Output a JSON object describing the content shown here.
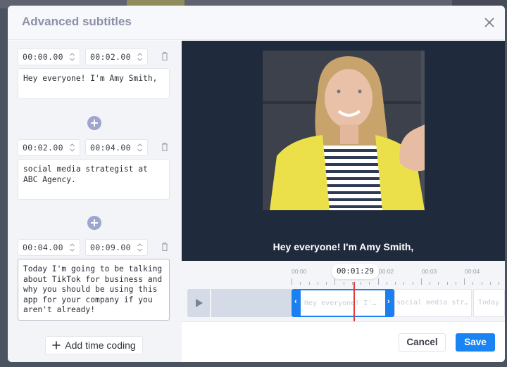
{
  "modal": {
    "title": "Advanced subtitles",
    "close_icon": "close-icon"
  },
  "cues": [
    {
      "start": "00:00.00",
      "end": "00:02.00",
      "text": "Hey everyone! I'm Amy Smith,"
    },
    {
      "start": "00:02.00",
      "end": "00:04.00",
      "text": "social media strategist at ABC Agency."
    },
    {
      "start": "00:04.00",
      "end": "00:09.00",
      "text": "Today I'm going to be talking about TikTok for business and why you should be using this app for your company if you aren't already!"
    }
  ],
  "add_time_coding_label": "Add time coding",
  "preview": {
    "subtitle": "Hey everyone! I'm Amy Smith,"
  },
  "timeline": {
    "current_time": "00:01:29",
    "ruler_labels": [
      "00:00",
      "00:02",
      "00:03",
      "00:04"
    ],
    "clips": [
      {
        "label": "Hey everyone! I'…"
      },
      {
        "label": "social media str…"
      },
      {
        "label": "Today"
      }
    ]
  },
  "footer": {
    "cancel_label": "Cancel",
    "save_label": "Save"
  },
  "colors": {
    "accent": "#1a84f5",
    "playhead": "#e03a3a",
    "video_bg": "#1f2a3c"
  }
}
